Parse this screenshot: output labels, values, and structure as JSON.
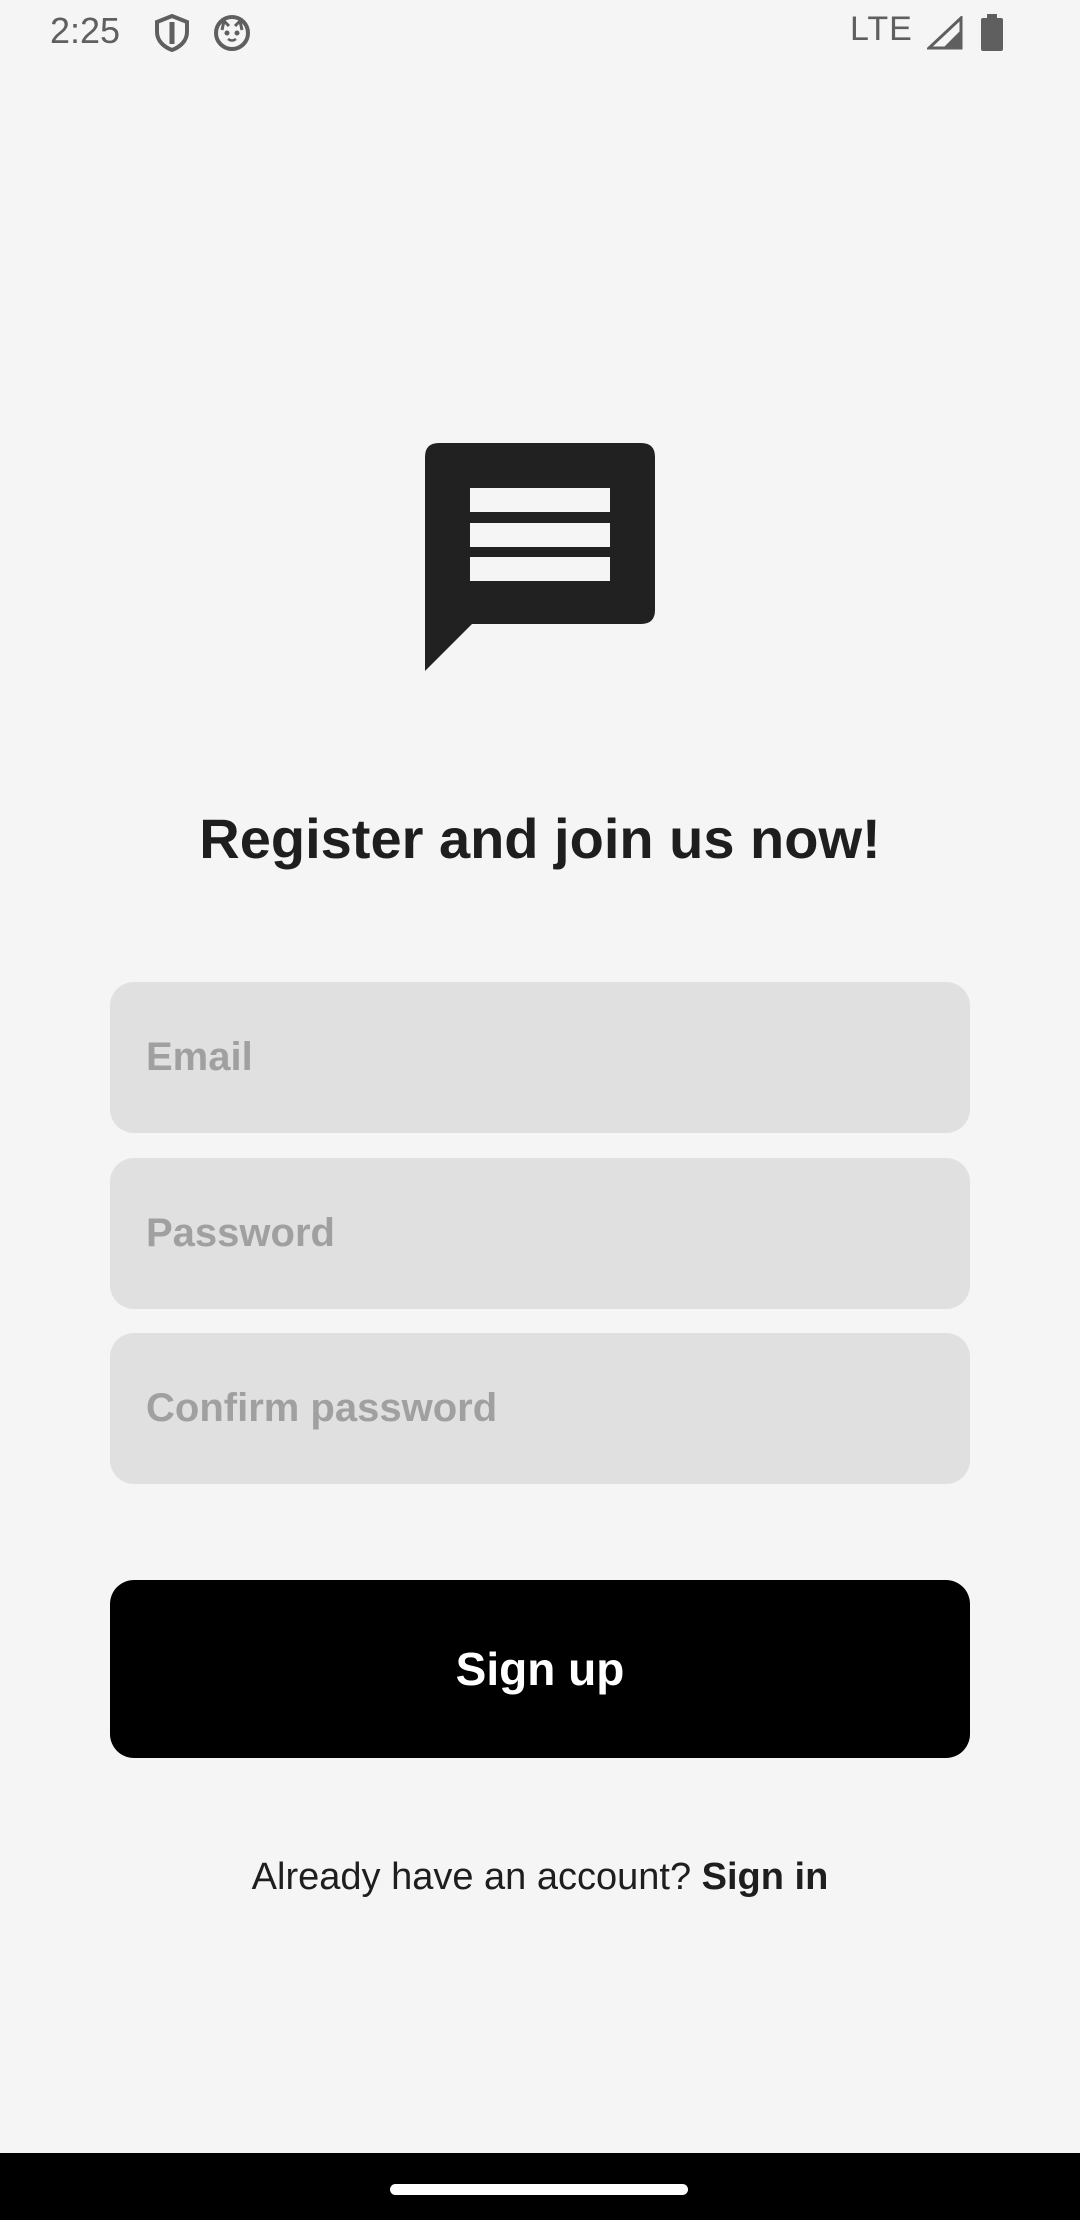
{
  "status_bar": {
    "time": "2:25",
    "network": "LTE",
    "icons": [
      "shield-icon",
      "cat-icon",
      "signal-icon",
      "battery-icon"
    ]
  },
  "logo": {
    "icon": "chat-bubble-icon"
  },
  "title": "Register and join us now!",
  "form": {
    "email": {
      "placeholder": "Email",
      "value": ""
    },
    "password": {
      "placeholder": "Password",
      "value": ""
    },
    "confirm_password": {
      "placeholder": "Confirm password",
      "value": ""
    },
    "submit_label": "Sign up"
  },
  "footer": {
    "prompt": "Already have an account?",
    "link_label": "Sign in"
  },
  "colors": {
    "background": "#f5f5f5",
    "field_background": "#e0e0e0",
    "button_background": "#000000",
    "button_text": "#ffffff",
    "text": "#1e1e1e",
    "placeholder": "#a0a0a0"
  }
}
